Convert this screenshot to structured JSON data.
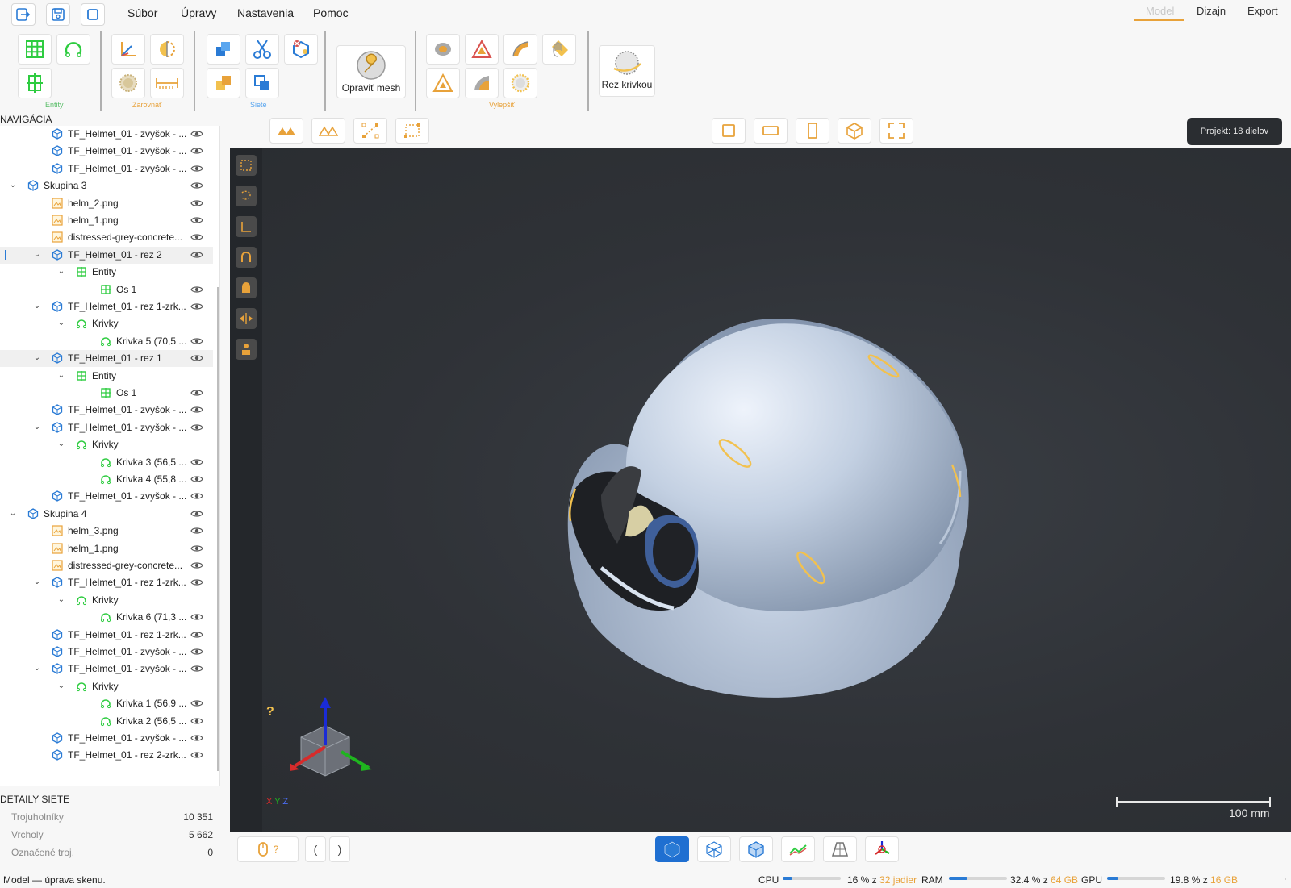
{
  "menu": {
    "items": [
      "Súbor",
      "Úpravy",
      "Nastavenia",
      "Pomoc"
    ],
    "modes": [
      "Model",
      "Dizajn",
      "Export"
    ],
    "active_mode": "Model"
  },
  "ribbon": {
    "groups": {
      "entity": "Entity",
      "align": "Zarovnať",
      "mesh": "Siete",
      "improve": "Vylepšiť"
    },
    "repair_mesh": "Opraviť mesh",
    "curve_cut": "Rez krivkou"
  },
  "navigation": {
    "title": "NAVIGÁCIA",
    "rows": [
      {
        "label": "TF_Helmet_01 - zvyšok - ...",
        "icon": "mesh",
        "level": 2
      },
      {
        "label": "TF_Helmet_01 - zvyšok - ...",
        "icon": "mesh",
        "level": 2
      },
      {
        "label": "TF_Helmet_01 - zvyšok - ...",
        "icon": "mesh",
        "level": 2
      },
      {
        "label": "Skupina 3",
        "icon": "mesh",
        "level": 1,
        "expanded": true
      },
      {
        "label": "helm_2.png",
        "icon": "image",
        "level": 2
      },
      {
        "label": "helm_1.png",
        "icon": "image",
        "level": 2
      },
      {
        "label": "distressed-grey-concrete...",
        "icon": "image",
        "level": 2
      },
      {
        "label": "TF_Helmet_01 - rez 2",
        "icon": "mesh",
        "level": 2,
        "expanded": true,
        "selected": true
      },
      {
        "label": "Entity",
        "icon": "entity",
        "level": 3,
        "expanded": true,
        "noeye": true
      },
      {
        "label": "Os 1",
        "icon": "entity",
        "level": 4
      },
      {
        "label": "TF_Helmet_01 - rez 1-zrk...",
        "icon": "mesh",
        "level": 2,
        "expanded": true
      },
      {
        "label": "Krivky",
        "icon": "curve",
        "level": 3,
        "expanded": true,
        "noeye": true
      },
      {
        "label": "Krivka 5  (70,5 ...",
        "icon": "curve",
        "level": 4
      },
      {
        "label": "TF_Helmet_01 - rez 1",
        "icon": "mesh",
        "level": 2,
        "expanded": true,
        "selected": true
      },
      {
        "label": "Entity",
        "icon": "entity",
        "level": 3,
        "expanded": true,
        "noeye": true
      },
      {
        "label": "Os 1",
        "icon": "entity",
        "level": 4
      },
      {
        "label": "TF_Helmet_01 - zvyšok - ...",
        "icon": "mesh",
        "level": 2
      },
      {
        "label": "TF_Helmet_01 - zvyšok - ...",
        "icon": "mesh",
        "level": 2,
        "expanded": true
      },
      {
        "label": "Krivky",
        "icon": "curve",
        "level": 3,
        "expanded": true,
        "noeye": true
      },
      {
        "label": "Krivka 3  (56,5 ...",
        "icon": "curve",
        "level": 4
      },
      {
        "label": "Krivka 4  (55,8 ...",
        "icon": "curve",
        "level": 4
      },
      {
        "label": "TF_Helmet_01 - zvyšok - ...",
        "icon": "mesh",
        "level": 2
      },
      {
        "label": "Skupina 4",
        "icon": "mesh",
        "level": 1,
        "expanded": true
      },
      {
        "label": "helm_3.png",
        "icon": "image",
        "level": 2
      },
      {
        "label": "helm_1.png",
        "icon": "image",
        "level": 2
      },
      {
        "label": "distressed-grey-concrete...",
        "icon": "image",
        "level": 2
      },
      {
        "label": "TF_Helmet_01 - rez 1-zrk...",
        "icon": "mesh",
        "level": 2,
        "expanded": true
      },
      {
        "label": "Krivky",
        "icon": "curve",
        "level": 3,
        "expanded": true,
        "noeye": true
      },
      {
        "label": "Krivka 6  (71,3 ...",
        "icon": "curve",
        "level": 4
      },
      {
        "label": "TF_Helmet_01 - rez 1-zrk...",
        "icon": "mesh",
        "level": 2
      },
      {
        "label": "TF_Helmet_01 - zvyšok - ...",
        "icon": "mesh",
        "level": 2
      },
      {
        "label": "TF_Helmet_01 - zvyšok - ...",
        "icon": "mesh",
        "level": 2,
        "expanded": true
      },
      {
        "label": "Krivky",
        "icon": "curve",
        "level": 3,
        "expanded": true,
        "noeye": true
      },
      {
        "label": "Krivka 1  (56,9 ...",
        "icon": "curve",
        "level": 4
      },
      {
        "label": "Krivka 2  (56,5 ...",
        "icon": "curve",
        "level": 4
      },
      {
        "label": "TF_Helmet_01 - zvyšok - ...",
        "icon": "mesh",
        "level": 2
      },
      {
        "label": "TF_Helmet_01 - rez 2-zrk...",
        "icon": "mesh",
        "level": 2
      }
    ]
  },
  "details": {
    "title": "DETAILY SIETE",
    "rows": [
      {
        "label": "Trojuholníky",
        "value": "10 351"
      },
      {
        "label": "Vrcholy",
        "value": "5 662"
      },
      {
        "label": "Označené troj.",
        "value": "0"
      }
    ]
  },
  "viewport": {
    "project_badge": "Projekt: 18 dielov",
    "scale_label": "100 mm",
    "help_glyph": "?",
    "axes": {
      "x": "X",
      "y": "Y",
      "z": "Z"
    }
  },
  "bottom": {
    "mouse_hint": "?",
    "nav_prev": "(",
    "nav_next": ")"
  },
  "status": {
    "text": "Model — úprava skenu.",
    "cpu": {
      "label": "CPU",
      "value": "16 % z ",
      "total": "32 jadier",
      "fraction": 0.16
    },
    "ram": {
      "label": "RAM",
      "value": "32.4 % z ",
      "total": "64 GB",
      "fraction": 0.324
    },
    "gpu": {
      "label": "GPU",
      "value": "19.8 % z ",
      "total": "16 GB",
      "fraction": 0.198
    }
  },
  "colors": {
    "accent_blue": "#2a7bd5",
    "accent_orange": "#e8a23a",
    "green": "#2ecc40",
    "viewport_bg": "#2f3237"
  }
}
